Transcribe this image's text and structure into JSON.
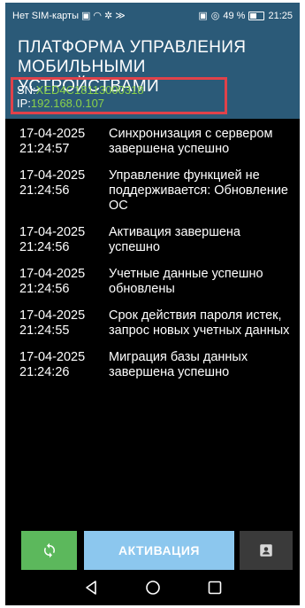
{
  "status_bar": {
    "carrier": "Нет SIM-карты",
    "battery_percent": "49 %",
    "time": "21:25"
  },
  "header": {
    "title_line1": "ПЛАТФОРМА УПРАВЛЕНИЯ",
    "title_line2": "МОБИЛЬНЫМИ УСТРОЙСТВАМИ",
    "sn_label": "SN:",
    "sn_value": "XED4C18113000318",
    "ip_label": "IP:",
    "ip_value": "192.168.0.107"
  },
  "log": [
    {
      "date": "17-04-2025",
      "time": "21:24:57",
      "message": "Синхронизация с сервером завершена успешно"
    },
    {
      "date": "17-04-2025",
      "time": "21:24:56",
      "message": "Управление функцией не поддерживается: Обновление ОС"
    },
    {
      "date": "17-04-2025",
      "time": "21:24:56",
      "message": "Активация завершена успешно"
    },
    {
      "date": "17-04-2025",
      "time": "21:24:56",
      "message": "Учетные данные успешно обновлены"
    },
    {
      "date": "17-04-2025",
      "time": "21:24:55",
      "message": "Срок действия пароля истек, запрос новых учетных данных"
    },
    {
      "date": "17-04-2025",
      "time": "21:24:26",
      "message": "Миграция базы данных завершена успешно"
    }
  ],
  "buttons": {
    "activate_label": "АКТИВАЦИЯ",
    "sync_icon": "sync-icon",
    "contact_icon": "contact-card-icon"
  },
  "colors": {
    "header_bg": "#2b5a78",
    "highlight_value": "#8ad14a",
    "highlight_border": "#e0424a",
    "sync_button": "#5cb85c",
    "activate_button": "#8cc7ee",
    "contact_button": "#3a3a3a"
  }
}
